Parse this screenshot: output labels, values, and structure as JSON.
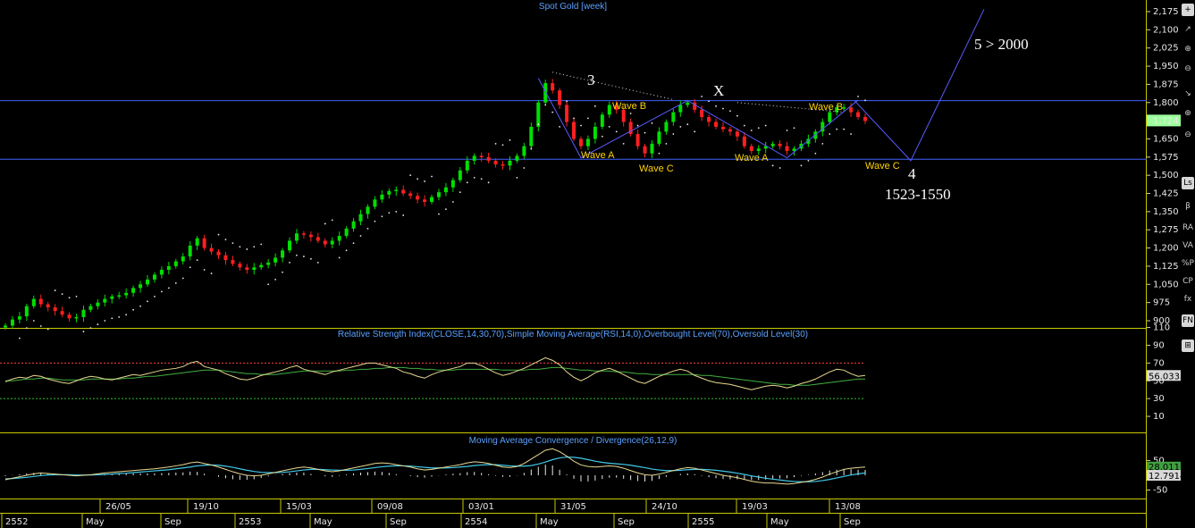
{
  "panels": {
    "price_title": "Spot Gold [week]",
    "rsi_title": "Relative Strength Index(CLOSE,14,30,70),Simple Moving Average(RSI,14,0),Overbought Level(70),Oversold Level(30)",
    "macd_title": "Moving Average Convergence / Divergence(26,12,9)"
  },
  "toolbar": {
    "items": [
      "+",
      "↗",
      "⊕",
      "⊖",
      "↘",
      "⊕",
      "⊖",
      "Ls",
      "β",
      "RA",
      "VA",
      "%P",
      "CP",
      "fx",
      "FN",
      "⊞"
    ]
  },
  "chart_data": [
    {
      "type": "candlestick",
      "title": "Spot Gold [week]",
      "y_ticks": [
        "2,175",
        "2,100",
        "2,025",
        "1,950",
        "1,875",
        "1,800",
        "1,724.0",
        "1,650",
        "1,575",
        "1,500",
        "1,425",
        "1,350",
        "1,275",
        "1,200",
        "1,125",
        "1,050",
        "975",
        "900"
      ],
      "ylim": [
        880,
        2190
      ],
      "last_value": "1,724.0",
      "horizontal_lines": [
        1808,
        1566
      ],
      "x_date_labels": [
        "26/05",
        "19/10",
        "15/03",
        "09/08",
        "03/01",
        "31/05",
        "24/10",
        "19/03",
        "13/08"
      ],
      "x_period_labels": [
        "2552",
        "May",
        "Sep",
        "2553",
        "May",
        "Sep",
        "2554",
        "May",
        "Sep",
        "2555",
        "May",
        "Sep"
      ],
      "closes": [
        880,
        905,
        918,
        960,
        990,
        968,
        955,
        940,
        925,
        910,
        915,
        945,
        960,
        975,
        990,
        1000,
        1005,
        1015,
        1035,
        1050,
        1070,
        1090,
        1110,
        1125,
        1145,
        1165,
        1210,
        1240,
        1200,
        1185,
        1170,
        1150,
        1135,
        1120,
        1110,
        1120,
        1130,
        1140,
        1160,
        1190,
        1230,
        1260,
        1255,
        1245,
        1230,
        1215,
        1230,
        1250,
        1280,
        1310,
        1340,
        1370,
        1400,
        1420,
        1435,
        1440,
        1425,
        1415,
        1400,
        1390,
        1410,
        1430,
        1450,
        1480,
        1520,
        1560,
        1580,
        1575,
        1560,
        1545,
        1540,
        1560,
        1580,
        1620,
        1700,
        1800,
        1880,
        1850,
        1790,
        1720,
        1650,
        1620,
        1650,
        1700,
        1750,
        1790,
        1770,
        1720,
        1670,
        1620,
        1590,
        1630,
        1680,
        1720,
        1760,
        1790,
        1800,
        1770,
        1740,
        1720,
        1700,
        1690,
        1680,
        1660,
        1620,
        1600,
        1610,
        1620,
        1630,
        1620,
        1600,
        1610,
        1630,
        1650,
        1680,
        1720,
        1760,
        1780,
        1780,
        1760,
        1740,
        1724
      ],
      "annotations": [
        {
          "text": "3",
          "color": "white"
        },
        {
          "text": "X",
          "color": "white"
        },
        {
          "text": "4",
          "color": "white"
        },
        {
          "text": "5 > 2000",
          "color": "white"
        },
        {
          "text": "1523-1550",
          "color": "white"
        },
        {
          "text": "Wave B",
          "color": "yellow"
        },
        {
          "text": "Wave A",
          "color": "yellow"
        },
        {
          "text": "Wave C",
          "color": "yellow"
        },
        {
          "text": "Wave A",
          "color": "yellow"
        },
        {
          "text": "Wave B",
          "color": "yellow"
        },
        {
          "text": "Wave C",
          "color": "yellow"
        }
      ],
      "projection_path": [
        [
          0,
          1810
        ],
        [
          24,
          1568
        ],
        [
          31,
          2175
        ]
      ]
    },
    {
      "type": "line",
      "title": "Relative Strength Index(CLOSE,14,30,70),Simple Moving Average(RSI,14,0),Overbought Level(70),Oversold Level(30)",
      "y_ticks": [
        "110",
        "90",
        "70",
        "50",
        "30",
        "10"
      ],
      "ylim": [
        0,
        120
      ],
      "overbought": 70,
      "oversold": 30,
      "last_value": "56.0335",
      "rsi": [
        49,
        52,
        54,
        53,
        56,
        55,
        52,
        50,
        48,
        47,
        50,
        53,
        55,
        54,
        52,
        51,
        53,
        55,
        57,
        56,
        58,
        60,
        62,
        63,
        64,
        66,
        70,
        72,
        66,
        64,
        62,
        58,
        55,
        52,
        51,
        53,
        56,
        58,
        60,
        62,
        65,
        67,
        63,
        61,
        59,
        57,
        60,
        62,
        64,
        66,
        68,
        70,
        70,
        68,
        66,
        64,
        60,
        58,
        55,
        53,
        57,
        60,
        62,
        64,
        66,
        70,
        70,
        67,
        63,
        59,
        56,
        58,
        61,
        64,
        68,
        72,
        76,
        73,
        68,
        60,
        54,
        50,
        54,
        59,
        62,
        64,
        61,
        57,
        53,
        49,
        47,
        51,
        55,
        58,
        61,
        63,
        61,
        56,
        53,
        50,
        48,
        47,
        46,
        44,
        42,
        40,
        42,
        44,
        45,
        44,
        42,
        44,
        47,
        49,
        52,
        56,
        60,
        63,
        62,
        58,
        55,
        56
      ],
      "sma": [
        50,
        50,
        51,
        52,
        52,
        53,
        53,
        52,
        51,
        51,
        51,
        51,
        52,
        52,
        52,
        52,
        52,
        53,
        53,
        54,
        55,
        55,
        56,
        57,
        58,
        59,
        60,
        61,
        62,
        62,
        62,
        61,
        60,
        59,
        58,
        58,
        57,
        57,
        57,
        58,
        59,
        60,
        61,
        61,
        61,
        61,
        61,
        61,
        62,
        62,
        63,
        63,
        64,
        64,
        65,
        65,
        65,
        64,
        64,
        63,
        63,
        62,
        62,
        62,
        63,
        63,
        63,
        63,
        63,
        63,
        62,
        62,
        62,
        62,
        63,
        63,
        64,
        65,
        65,
        64,
        63,
        62,
        62,
        61,
        61,
        61,
        60,
        60,
        59,
        58,
        58,
        57,
        57,
        57,
        57,
        57,
        57,
        57,
        56,
        56,
        55,
        54,
        53,
        52,
        51,
        50,
        49,
        48,
        47,
        46,
        46,
        45,
        45,
        45,
        46,
        47,
        48,
        49,
        50,
        51,
        52,
        52
      ]
    },
    {
      "type": "line",
      "title": "Moving Average Convergence / Divergence(26,12,9)",
      "y_ticks": [
        "50",
        "-50"
      ],
      "ylim": [
        -90,
        130
      ],
      "last_values": [
        "28.011",
        "12.7914"
      ],
      "macd": [
        -15,
        -10,
        -5,
        0,
        5,
        8,
        6,
        4,
        2,
        0,
        -2,
        0,
        2,
        5,
        8,
        10,
        12,
        14,
        16,
        18,
        20,
        22,
        25,
        28,
        32,
        36,
        42,
        45,
        40,
        35,
        28,
        20,
        12,
        5,
        0,
        -2,
        0,
        5,
        10,
        15,
        20,
        25,
        28,
        25,
        20,
        15,
        12,
        15,
        20,
        25,
        30,
        35,
        40,
        42,
        40,
        36,
        32,
        28,
        22,
        18,
        20,
        24,
        28,
        32,
        36,
        42,
        46,
        44,
        40,
        34,
        28,
        26,
        30,
        40,
        55,
        70,
        85,
        90,
        80,
        65,
        48,
        35,
        30,
        28,
        30,
        32,
        30,
        24,
        16,
        8,
        2,
        0,
        4,
        10,
        16,
        22,
        26,
        24,
        18,
        12,
        6,
        0,
        -4,
        -8,
        -14,
        -20,
        -24,
        -26,
        -26,
        -28,
        -30,
        -28,
        -24,
        -20,
        -14,
        -6,
        4,
        12,
        20,
        24,
        26,
        28
      ],
      "signal": [
        -12,
        -11,
        -9,
        -7,
        -4,
        -1,
        1,
        2,
        2,
        2,
        1,
        1,
        1,
        2,
        3,
        4,
        6,
        7,
        9,
        11,
        13,
        15,
        17,
        19,
        22,
        25,
        28,
        32,
        34,
        35,
        34,
        31,
        27,
        22,
        17,
        13,
        10,
        9,
        9,
        10,
        12,
        15,
        18,
        20,
        20,
        19,
        18,
        17,
        17,
        18,
        20,
        23,
        26,
        29,
        31,
        32,
        32,
        31,
        29,
        27,
        25,
        25,
        25,
        26,
        28,
        30,
        33,
        35,
        36,
        36,
        34,
        32,
        31,
        31,
        33,
        38,
        45,
        53,
        59,
        62,
        61,
        58,
        53,
        48,
        44,
        41,
        39,
        37,
        34,
        30,
        26,
        21,
        18,
        16,
        16,
        17,
        19,
        20,
        20,
        19,
        17,
        14,
        11,
        7,
        3,
        -2,
        -6,
        -10,
        -13,
        -16,
        -19,
        -21,
        -22,
        -22,
        -21,
        -18,
        -14,
        -9,
        -4,
        1,
        5,
        8
      ]
    }
  ]
}
